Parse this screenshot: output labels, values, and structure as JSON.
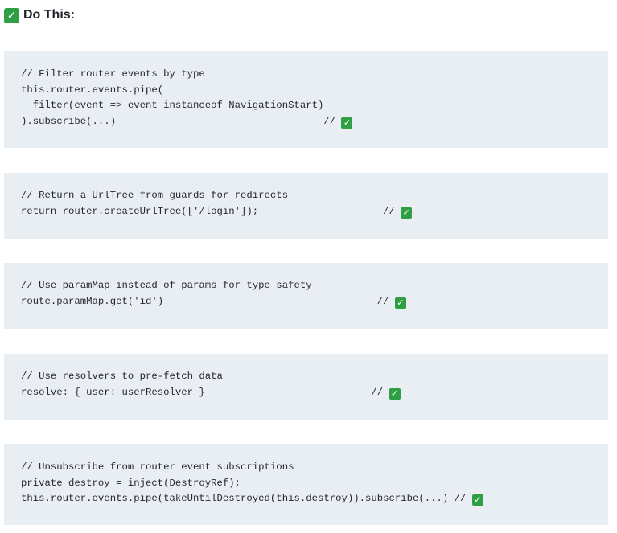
{
  "heading": {
    "icon": "check-mark-button-icon",
    "text": "Do This:",
    "color": "#2ea043"
  },
  "code_blocks": [
    {
      "lines": [
        {
          "text": "// Filter router events by type",
          "check": false
        },
        {
          "text": "this.router.events.pipe(",
          "check": false
        },
        {
          "text": "  filter(event => event instanceof NavigationStart)",
          "check": false
        },
        {
          "text": ").subscribe(...)                                   // ",
          "check": true
        }
      ]
    },
    {
      "lines": [
        {
          "text": "// Return a UrlTree from guards for redirects",
          "check": false
        },
        {
          "text": "return router.createUrlTree(['/login']);                     // ",
          "check": true
        }
      ]
    },
    {
      "lines": [
        {
          "text": "// Use paramMap instead of params for type safety",
          "check": false
        },
        {
          "text": "route.paramMap.get('id')                                    // ",
          "check": true
        }
      ]
    },
    {
      "lines": [
        {
          "text": "// Use resolvers to pre-fetch data",
          "check": false
        },
        {
          "text": "resolve: { user: userResolver }                            // ",
          "check": true
        }
      ]
    },
    {
      "lines": [
        {
          "text": "// Unsubscribe from router event subscriptions",
          "check": false
        },
        {
          "text": "private destroy = inject(DestroyRef);",
          "check": false
        },
        {
          "text": "this.router.events.pipe(takeUntilDestroyed(this.destroy)).subscribe(...) // ",
          "check": true
        }
      ]
    }
  ],
  "check_glyph": "✓",
  "code_background": "#e9eef2"
}
